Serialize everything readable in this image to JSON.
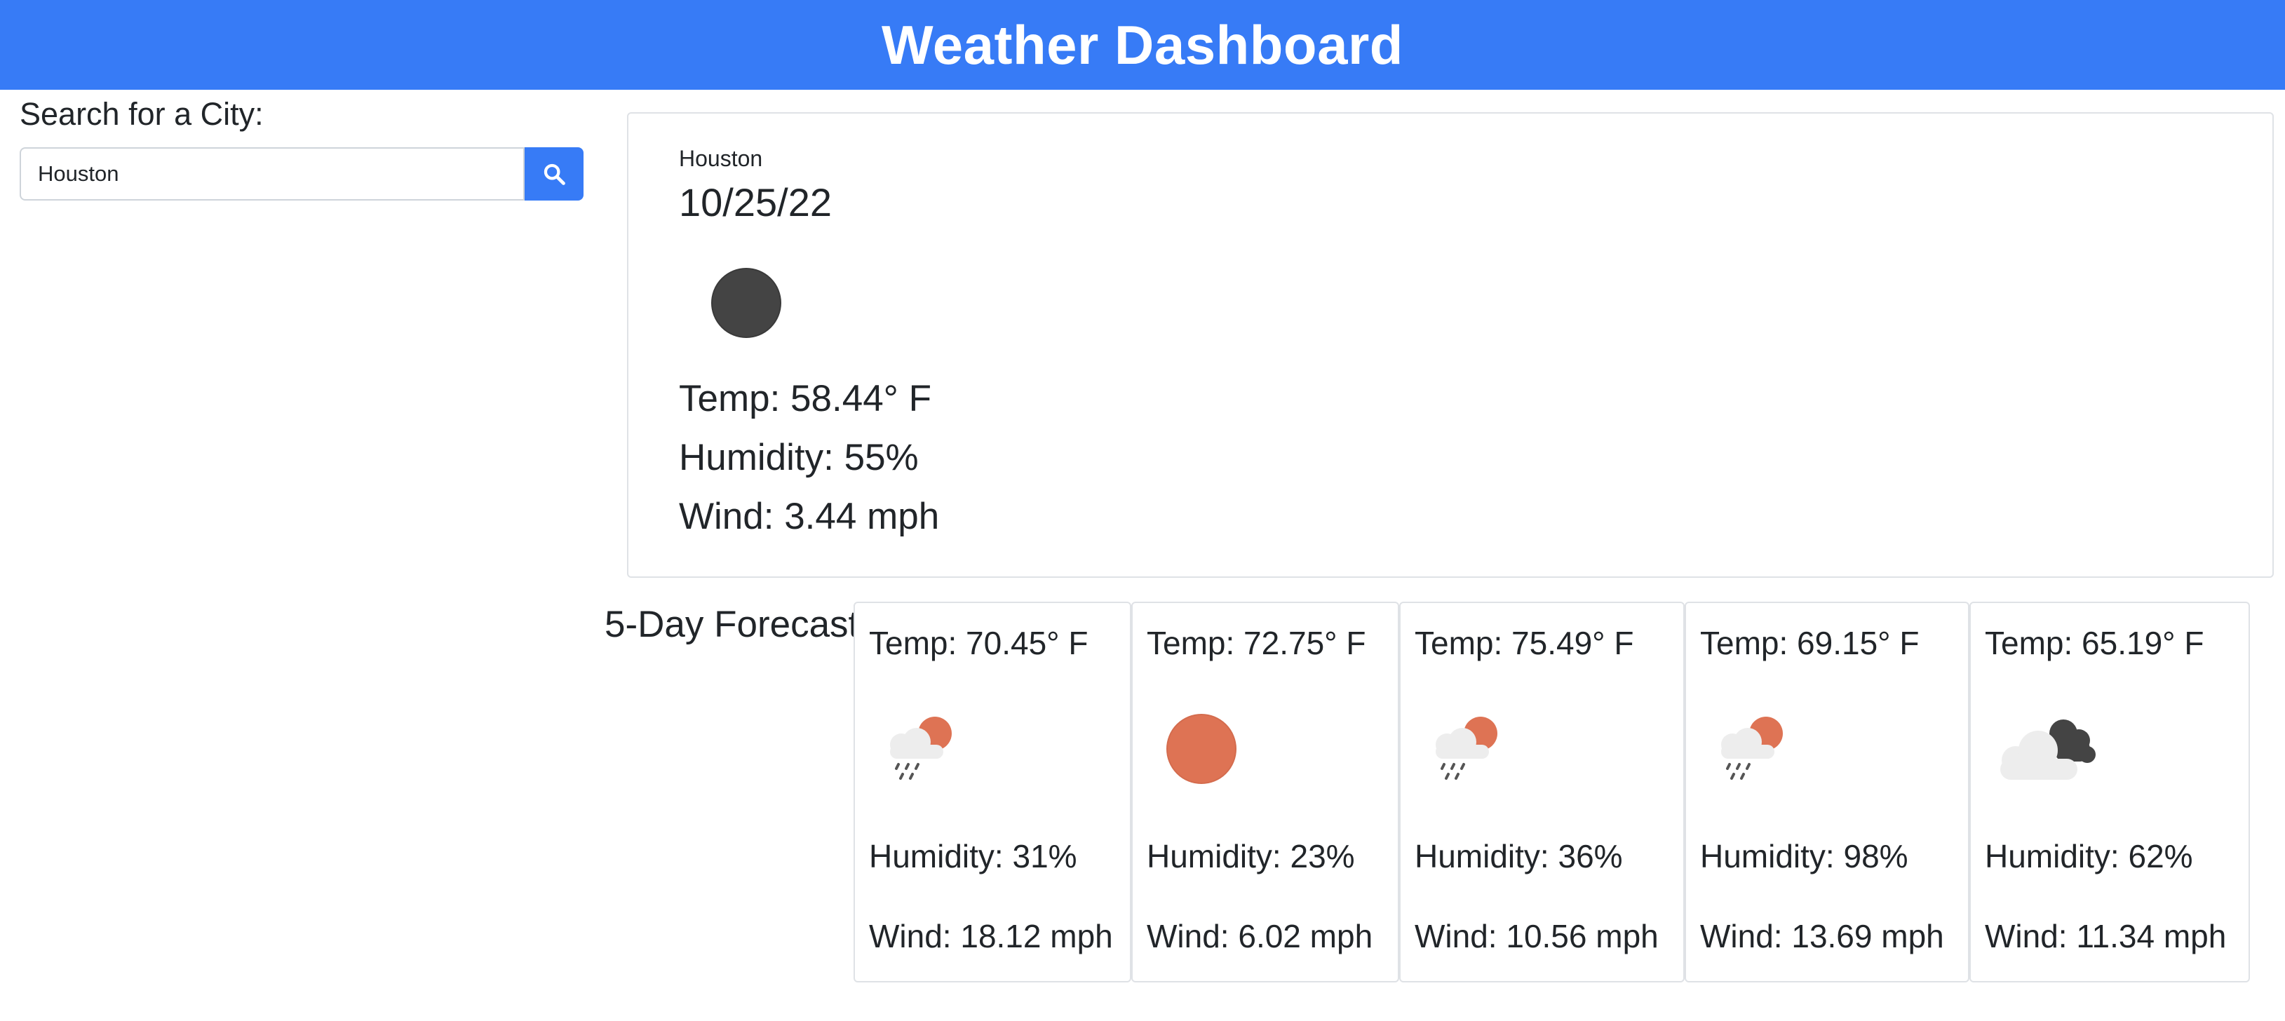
{
  "header": {
    "title": "Weather Dashboard"
  },
  "search": {
    "label": "Search for a City:",
    "value": "Houston",
    "button_icon": "search-icon"
  },
  "current": {
    "city": "Houston",
    "date": "10/25/22",
    "icon": "clear-night-icon",
    "temp": "Temp: 58.44° F",
    "humidity": "Humidity: 55%",
    "wind": "Wind: 3.44 mph"
  },
  "forecast": {
    "heading": "5-Day Forecast",
    "days": [
      {
        "temp": "Temp: 70.45° F",
        "icon": "rain-sun-icon",
        "humidity": "Humidity: 31%",
        "wind": "Wind: 18.12 mph"
      },
      {
        "temp": "Temp: 72.75° F",
        "icon": "clear-day-icon",
        "humidity": "Humidity: 23%",
        "wind": "Wind: 6.02 mph"
      },
      {
        "temp": "Temp: 75.49° F",
        "icon": "rain-sun-icon",
        "humidity": "Humidity: 36%",
        "wind": "Wind: 10.56 mph"
      },
      {
        "temp": "Temp: 69.15° F",
        "icon": "rain-sun-icon",
        "humidity": "Humidity: 98%",
        "wind": "Wind: 13.69 mph"
      },
      {
        "temp": "Temp: 65.19° F",
        "icon": "cloudy-night-icon",
        "humidity": "Humidity: 62%",
        "wind": "Wind: 11.34 mph"
      }
    ]
  },
  "colors": {
    "header_bg": "#377bf6",
    "sun": "#de7354",
    "moon": "#444444",
    "cloud_light": "#eeeeee",
    "rain": "#555555",
    "card_border": "#dfe2e6"
  }
}
